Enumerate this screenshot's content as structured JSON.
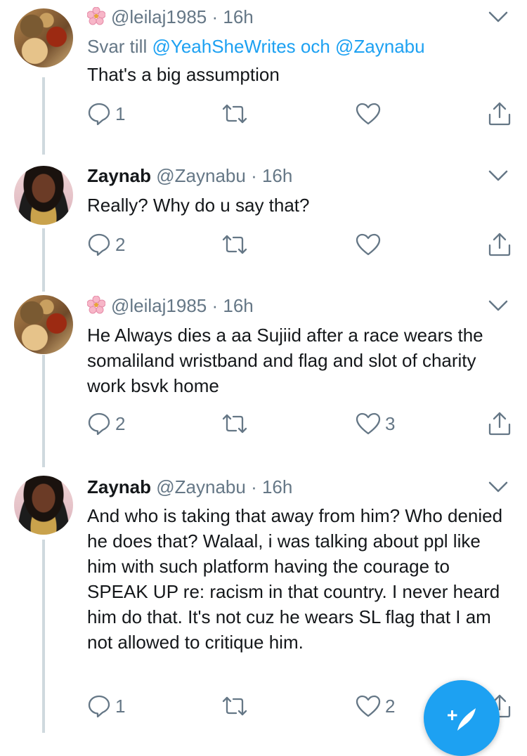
{
  "tweets": [
    {
      "handle": "@leilaj1985",
      "time": "· 16h",
      "has_flower": true,
      "reply_prefix": "Svar till",
      "reply_users": "@YeahSheWrites och @Zaynabu",
      "text": "That's a big assumption",
      "counts": {
        "reply": "1",
        "retweet": "",
        "like": ""
      }
    },
    {
      "name": "Zaynab",
      "handle": "@Zaynabu",
      "time": "· 16h",
      "text": "Really? Why do u say that?",
      "counts": {
        "reply": "2",
        "retweet": "",
        "like": ""
      }
    },
    {
      "handle": "@leilaj1985",
      "time": "· 16h",
      "has_flower": true,
      "text": "He Always dies a aa Sujiid after a race  wears the somaliland wristband and flag and slot of charity work bsvk home",
      "counts": {
        "reply": "2",
        "retweet": "",
        "like": "3"
      }
    },
    {
      "name": "Zaynab",
      "handle": "@Zaynabu",
      "time": "· 16h",
      "text": "And who is taking that away from him? Who denied he does that? Walaal, i was talking about ppl like him with such platform having the courage to SPEAK UP re: racism in that country. I never heard him do that. It's not cuz he wears SL flag that I am not allowed to critique him.",
      "counts": {
        "reply": "1",
        "retweet": "",
        "like": "2"
      }
    }
  ],
  "icons": {
    "reply": "reply-icon",
    "retweet": "retweet-icon",
    "like": "like-icon",
    "share": "share-icon",
    "more": "chevron-down-icon",
    "compose": "compose-tweet-icon"
  },
  "colors": {
    "accent": "#1da1f2",
    "secondary_text": "#657786",
    "thread_line": "#cfd9de"
  }
}
